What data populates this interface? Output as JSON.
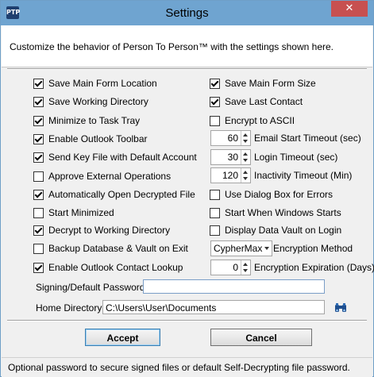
{
  "window": {
    "title": "Settings",
    "close_label": "✕",
    "app_icon_label": "PTP"
  },
  "header": {
    "description": "Customize the behavior of Person To Person™ with the settings shown here."
  },
  "left_options": [
    {
      "label": "Save Main Form Location",
      "checked": true
    },
    {
      "label": "Save Working Directory",
      "checked": true
    },
    {
      "label": "Minimize to Task Tray",
      "checked": true
    },
    {
      "label": "Enable Outlook Toolbar",
      "checked": true
    },
    {
      "label": "Send Key File with Default Account",
      "checked": true
    },
    {
      "label": "Approve External Operations",
      "checked": false
    },
    {
      "label": "Automatically Open Decrypted File",
      "checked": true
    },
    {
      "label": "Start Minimized",
      "checked": false
    },
    {
      "label": "Decrypt to Working Directory",
      "checked": true
    },
    {
      "label": "Backup Database & Vault on Exit",
      "checked": false
    },
    {
      "label": "Enable Outlook Contact Lookup",
      "checked": true
    }
  ],
  "right_options": {
    "save_main_form_size": {
      "label": "Save Main Form Size",
      "checked": true
    },
    "save_last_contact": {
      "label": "Save Last Contact",
      "checked": true
    },
    "encrypt_to_ascii": {
      "label": "Encrypt to ASCII",
      "checked": false
    },
    "email_start_timeout": {
      "value": "60",
      "label": "Email Start Timeout (sec)"
    },
    "login_timeout": {
      "value": "30",
      "label": "Login Timeout (sec)"
    },
    "inactivity_timeout": {
      "value": "120",
      "label": "Inactivity Timeout (Min)"
    },
    "use_dialog_box": {
      "label": "Use Dialog Box for Errors",
      "checked": false
    },
    "start_when_windows_starts": {
      "label": "Start When Windows Starts",
      "checked": false
    },
    "display_data_vault": {
      "label": "Display Data Vault on Login",
      "checked": false
    },
    "encryption_method": {
      "value": "CypherMax",
      "label": "Encryption Method"
    },
    "encryption_expiration": {
      "value": "0",
      "label": "Encryption Expiration (Days)"
    }
  },
  "fields": {
    "signing_password": {
      "label": "Signing/Default Password",
      "value": ""
    },
    "home_directory": {
      "label": "Home Directory",
      "value": "C:\\Users\\User\\Documents"
    }
  },
  "buttons": {
    "accept": "Accept",
    "cancel": "Cancel"
  },
  "status": "Optional password to secure signed files or default Self-Decrypting file password."
}
